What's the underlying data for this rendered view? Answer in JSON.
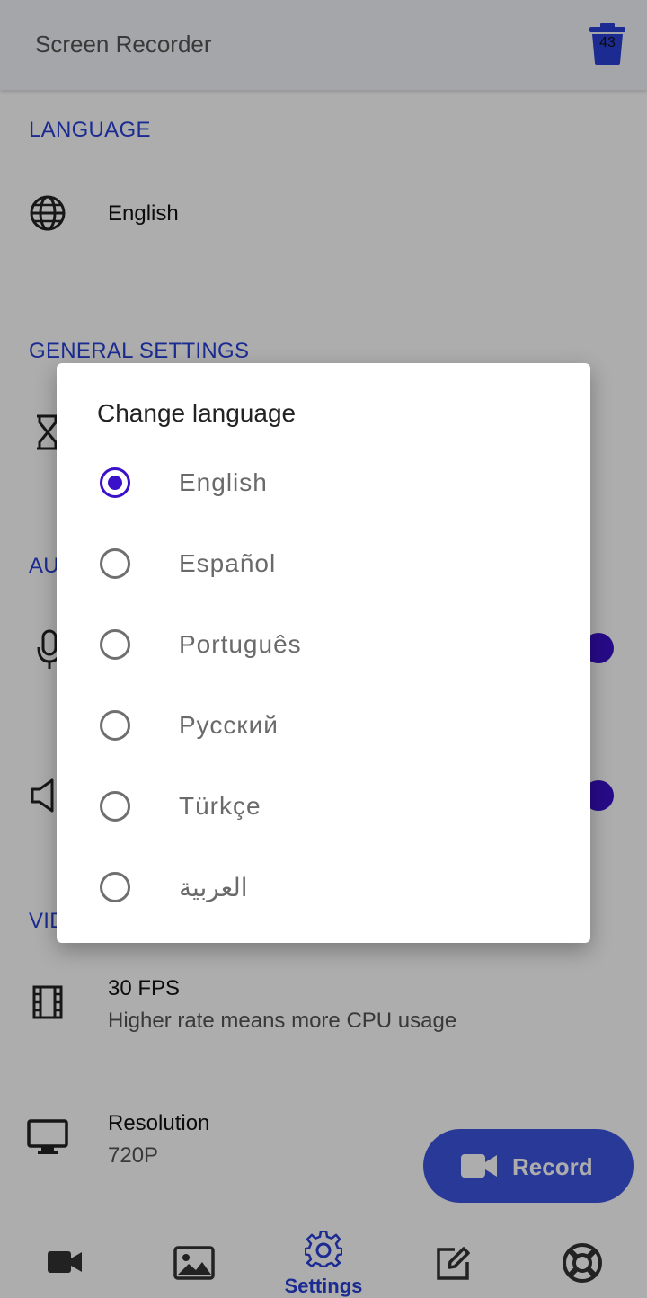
{
  "app": {
    "title": "Screen Recorder",
    "trash_count": "43"
  },
  "sections": {
    "language_header": "LANGUAGE",
    "general_header": "GENERAL SETTINGS",
    "audio_header_partial": "AU",
    "video_header_partial": "VID"
  },
  "language_row": {
    "value": "English"
  },
  "video": {
    "fps_title": "30 FPS",
    "fps_subtitle": "Higher rate means more CPU usage",
    "resolution_title": "Resolution",
    "resolution_value": "720P"
  },
  "fab": {
    "label": "Record"
  },
  "bottom_nav": {
    "active": "Settings",
    "settings_label": "Settings"
  },
  "dialog": {
    "title": "Change language",
    "options": [
      {
        "label": "English",
        "selected": true
      },
      {
        "label": "Español",
        "selected": false
      },
      {
        "label": "Português",
        "selected": false
      },
      {
        "label": "Русский",
        "selected": false
      },
      {
        "label": "Türkçe",
        "selected": false
      },
      {
        "label": "العربية",
        "selected": false
      }
    ]
  },
  "colors": {
    "accent": "#2840d8",
    "radio_selected": "#3a10c9",
    "fab": "#3d54e0"
  }
}
